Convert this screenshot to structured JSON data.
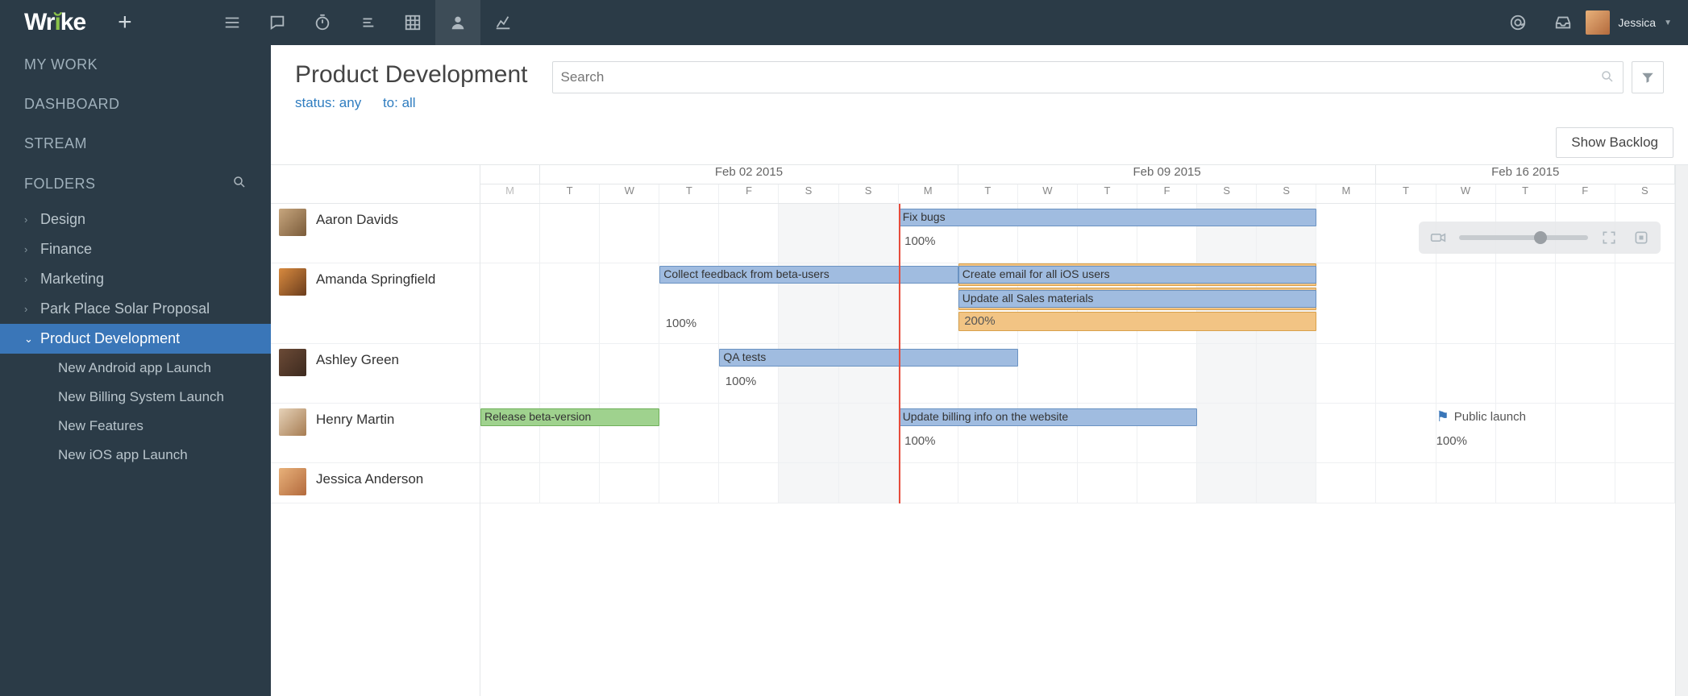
{
  "branding": {
    "logo_pre": "Wr",
    "logo_mid": "i",
    "logo_post": "ke"
  },
  "topnav": {
    "icons": [
      {
        "name": "hamburger-icon"
      },
      {
        "name": "chat-icon"
      },
      {
        "name": "timer-icon"
      },
      {
        "name": "list-icon"
      },
      {
        "name": "grid-icon"
      },
      {
        "name": "person-icon",
        "active": true
      },
      {
        "name": "chart-icon"
      }
    ],
    "right_icons": [
      {
        "name": "mention-icon"
      },
      {
        "name": "inbox-icon"
      }
    ]
  },
  "user": {
    "name": "Jessica"
  },
  "sidebar": {
    "nav": [
      {
        "label": "MY WORK",
        "name": "nav-my-work"
      },
      {
        "label": "DASHBOARD",
        "name": "nav-dashboard"
      },
      {
        "label": "STREAM",
        "name": "nav-stream"
      },
      {
        "label": "FOLDERS",
        "name": "nav-folders",
        "has_search": true
      }
    ],
    "folders": [
      {
        "label": "Design",
        "expanded": false
      },
      {
        "label": "Finance",
        "expanded": false
      },
      {
        "label": "Marketing",
        "expanded": false
      },
      {
        "label": "Park Place Solar Proposal",
        "expanded": false
      },
      {
        "label": "Product Development",
        "expanded": true,
        "children": [
          {
            "label": "New Android app Launch"
          },
          {
            "label": "New Billing System Launch"
          },
          {
            "label": "New Features"
          },
          {
            "label": "New iOS app Launch"
          }
        ]
      }
    ]
  },
  "page": {
    "title": "Product Development",
    "filters": {
      "status": "status: any",
      "to": "to: all"
    },
    "search_placeholder": "Search",
    "show_backlog": "Show Backlog"
  },
  "timeline": {
    "weeks": [
      {
        "label": "Feb 02 2015"
      },
      {
        "label": "Feb 09 2015"
      },
      {
        "label": "Feb 16 2015"
      }
    ],
    "day_labels": [
      "M",
      "T",
      "W",
      "T",
      "F",
      "S",
      "S",
      "M",
      "T",
      "W",
      "T",
      "F",
      "S",
      "S",
      "M",
      "T",
      "W",
      "T",
      "F",
      "S"
    ],
    "people": [
      {
        "name": "Aaron Davids"
      },
      {
        "name": "Amanda Springfield"
      },
      {
        "name": "Ashley Green"
      },
      {
        "name": "Henry Martin"
      },
      {
        "name": "Jessica Anderson"
      }
    ],
    "bars": {
      "aaron_fix": "Fix bugs",
      "aaron_pct": "100%",
      "amanda_collect": "Collect feedback from beta-users",
      "amanda_email": "Create email for all iOS users",
      "amanda_sales": "Update all Sales materials",
      "amanda_pct1": "100%",
      "amanda_pct2": "200%",
      "ashley_qa": "QA tests",
      "ashley_pct": "100%",
      "henry_release": "Release beta-version",
      "henry_billing": "Update billing info on the website",
      "henry_launch": "Public launch",
      "henry_pct1": "100%",
      "henry_pct2": "100%"
    }
  },
  "colors": {
    "accent_blue": "#3a76b8",
    "bar_blue": "#a0bce0",
    "bar_orange": "#f2c484",
    "bar_green": "#9fd28e",
    "today": "#e74c3c"
  },
  "chart_data": {
    "type": "gantt-workload",
    "date_range_start": "2015-02-02",
    "visible_today": "2015-02-09",
    "rows": [
      {
        "assignee": "Aaron Davids",
        "tasks": [
          {
            "label": "Fix bugs",
            "start": "2015-02-09",
            "end": "2015-02-15",
            "color": "blue"
          }
        ],
        "workload": [
          {
            "date": "2015-02-09",
            "pct": 100
          }
        ]
      },
      {
        "assignee": "Amanda Springfield",
        "tasks": [
          {
            "label": "Collect feedback from beta-users",
            "start": "2015-02-04",
            "end": "2015-02-08",
            "color": "blue"
          },
          {
            "label": "Create email for all iOS users",
            "start": "2015-02-10",
            "end": "2015-02-15",
            "color": "blue"
          },
          {
            "label": "Update all Sales materials",
            "start": "2015-02-10",
            "end": "2015-02-15",
            "color": "blue"
          }
        ],
        "workload": [
          {
            "date": "2015-02-04",
            "pct": 100
          },
          {
            "date": "2015-02-10",
            "pct": 200
          }
        ],
        "orange_overlays": [
          {
            "start": "2015-02-10",
            "end": "2015-02-15"
          }
        ]
      },
      {
        "assignee": "Ashley Green",
        "tasks": [
          {
            "label": "QA tests",
            "start": "2015-02-05",
            "end": "2015-02-10",
            "color": "blue"
          }
        ],
        "workload": [
          {
            "date": "2015-02-05",
            "pct": 100
          }
        ]
      },
      {
        "assignee": "Henry Martin",
        "tasks": [
          {
            "label": "Release beta-version",
            "start": "2015-02-02",
            "end": "2015-02-04",
            "color": "green"
          },
          {
            "label": "Update billing info on the website",
            "start": "2015-02-09",
            "end": "2015-02-13",
            "color": "blue"
          },
          {
            "label": "Public launch",
            "date": "2015-02-17",
            "type": "milestone"
          }
        ],
        "workload": [
          {
            "date": "2015-02-09",
            "pct": 100
          },
          {
            "date": "2015-02-17",
            "pct": 100
          }
        ]
      },
      {
        "assignee": "Jessica Anderson",
        "tasks": []
      }
    ]
  }
}
